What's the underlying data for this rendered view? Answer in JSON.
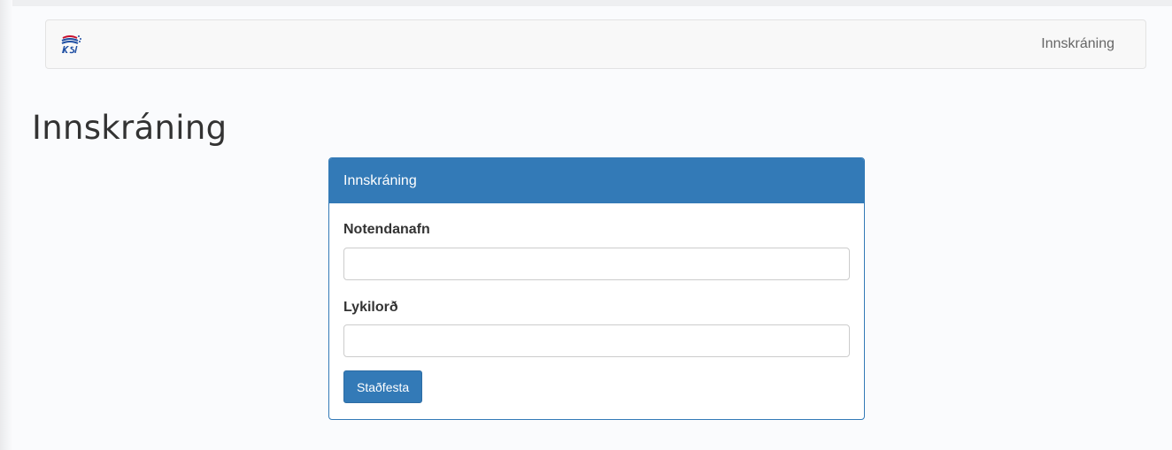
{
  "navbar": {
    "brand_icon": "ksi-logo",
    "login_link": "Innskráning"
  },
  "page": {
    "title": "Innskráning"
  },
  "login_panel": {
    "heading": "Innskráning",
    "username_label": "Notendanafn",
    "username_value": "",
    "password_label": "Lykilorð",
    "password_value": "",
    "submit_label": "Staðfesta"
  },
  "colors": {
    "primary": "#337ab7",
    "navbar_bg": "#f8f8f8",
    "page_bg": "#fafbfd"
  }
}
